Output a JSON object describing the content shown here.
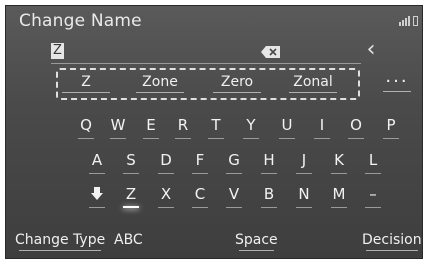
{
  "header": {
    "title": "Change Name"
  },
  "input": {
    "value": "Z"
  },
  "suggestions": [
    "Z",
    "Zone",
    "Zero",
    "Zonal"
  ],
  "more_label": "...",
  "keyboard": {
    "row1": [
      "Q",
      "W",
      "E",
      "R",
      "T",
      "Y",
      "U",
      "I",
      "O",
      "P"
    ],
    "row2": [
      "A",
      "S",
      "D",
      "F",
      "G",
      "H",
      "J",
      "K",
      "L"
    ],
    "row3": [
      "Z",
      "X",
      "C",
      "V",
      "B",
      "N",
      "M",
      "–"
    ],
    "shift_icon": "down-arrow-icon",
    "active_key": "Z"
  },
  "bottom_bar": {
    "change_type": "Change Type",
    "abc": "ABC",
    "space": "Space",
    "decision": "Decision"
  },
  "icons": {
    "back": "chevron-left-icon",
    "delete": "backspace-icon",
    "signal": "signal-icon",
    "battery": "battery-icon"
  },
  "colors": {
    "screen_bg": "#4a4a4a",
    "text": "#f0f0f0",
    "input_bg": "#e6e6e6"
  }
}
